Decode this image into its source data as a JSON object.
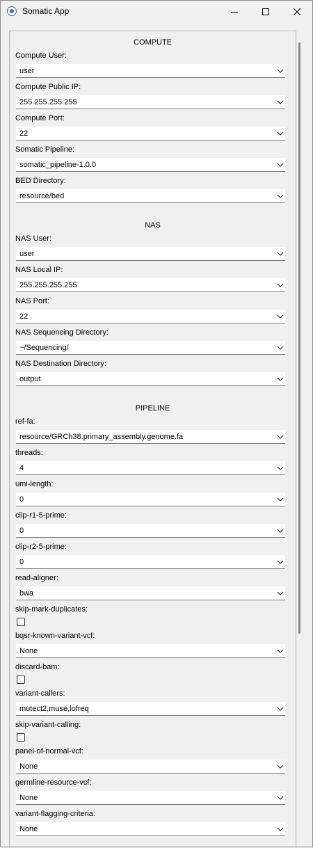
{
  "window": {
    "title": "Somatic App"
  },
  "compute": {
    "section_title": "COMPUTE",
    "fields": [
      {
        "label": "Compute User:",
        "value": "user"
      },
      {
        "label": "Compute Public IP:",
        "value": "255.255.255.255"
      },
      {
        "label": "Compute Port:",
        "value": "22"
      },
      {
        "label": "Somatic Pipeline:",
        "value": "somatic_pipeline-1.0.0"
      },
      {
        "label": "BED Directory:",
        "value": "resource/bed"
      }
    ]
  },
  "nas": {
    "section_title": "NAS",
    "fields": [
      {
        "label": "NAS User:",
        "value": "user"
      },
      {
        "label": "NAS Local IP:",
        "value": "255.255.255.255"
      },
      {
        "label": "NAS Port:",
        "value": "22"
      },
      {
        "label": "NAS Sequencing Directory:",
        "value": "~/Sequencing/"
      },
      {
        "label": "NAS Destination Directory:",
        "value": "output"
      }
    ]
  },
  "pipeline": {
    "section_title": "PIPELINE",
    "ref_fa": {
      "label": "ref-fa:",
      "value": "resource/GRCh38.primary_assembly.genome.fa"
    },
    "threads": {
      "label": "threads:",
      "value": "4"
    },
    "umi_length": {
      "label": "umi-length:",
      "value": "0"
    },
    "clip_r1": {
      "label": "clip-r1-5-prime:",
      "value": "0"
    },
    "clip_r2": {
      "label": "clip-r2-5-prime:",
      "value": "0"
    },
    "read_aligner": {
      "label": "read-aligner:",
      "value": "bwa"
    },
    "skip_mark_duplicates": {
      "label": "skip-mark-duplicates:",
      "checked": false
    },
    "bqsr": {
      "label": "bqsr-known-variant-vcf:",
      "value": "None"
    },
    "discard_bam": {
      "label": "discard-bam:",
      "checked": false
    },
    "variant_callers": {
      "label": "variant-callers:",
      "value": "mutect2,muse,lofreq"
    },
    "skip_variant_calling": {
      "label": "skip-variant-calling:",
      "checked": false
    },
    "panel_of_normal": {
      "label": "panel-of-normal-vcf:",
      "value": "None"
    },
    "germline_resource": {
      "label": "germline-resource-vcf:",
      "value": "None"
    },
    "variant_flagging": {
      "label": "variant-flagging-criteria:",
      "value": "None"
    }
  }
}
